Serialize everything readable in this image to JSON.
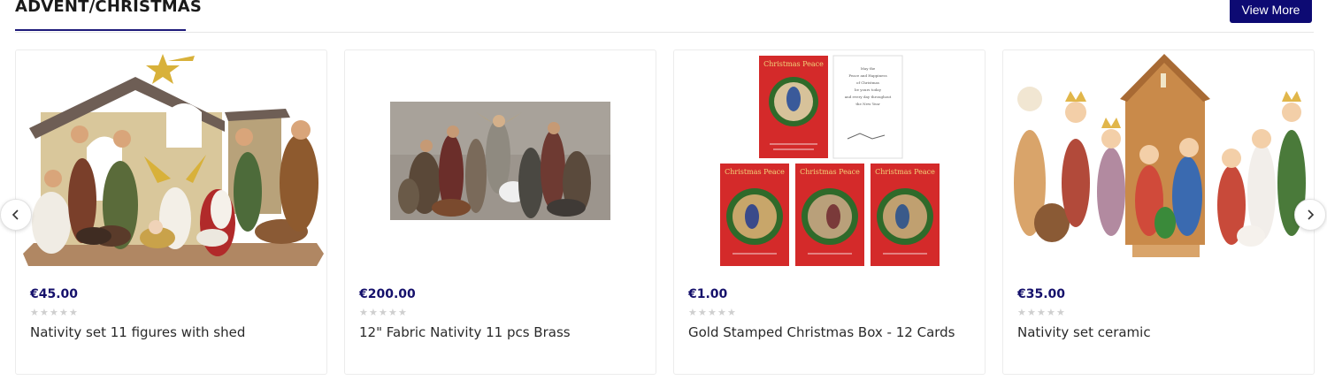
{
  "section": {
    "title": "ADVENT/CHRISTMAS",
    "view_more_label": "View More"
  },
  "carousel": {
    "prev_icon": "chevron-left-icon",
    "next_icon": "chevron-right-icon"
  },
  "products": [
    {
      "price": "€45.00",
      "name": "Nativity set 11 figures with shed",
      "rating": 0,
      "rating_max": 5
    },
    {
      "price": "€200.00",
      "name": "12\" Fabric Nativity 11 pcs Brass",
      "rating": 0,
      "rating_max": 5
    },
    {
      "price": "€1.00",
      "name": "Gold Stamped Christmas Box - 12 Cards",
      "rating": 0,
      "rating_max": 5
    },
    {
      "price": "€35.00",
      "name": "Nativity set ceramic",
      "rating": 0,
      "rating_max": 5
    }
  ],
  "card_images": {
    "card_title_text": "Christmas Peace",
    "card_inside_lines": [
      "May the",
      "Peace and Happiness",
      "of Christmas",
      "be yours today",
      "and every day throughout",
      "the New Year"
    ]
  },
  "colors": {
    "accent": "#0d0a73",
    "price": "#15106b",
    "star_empty": "#cfcfcf"
  }
}
